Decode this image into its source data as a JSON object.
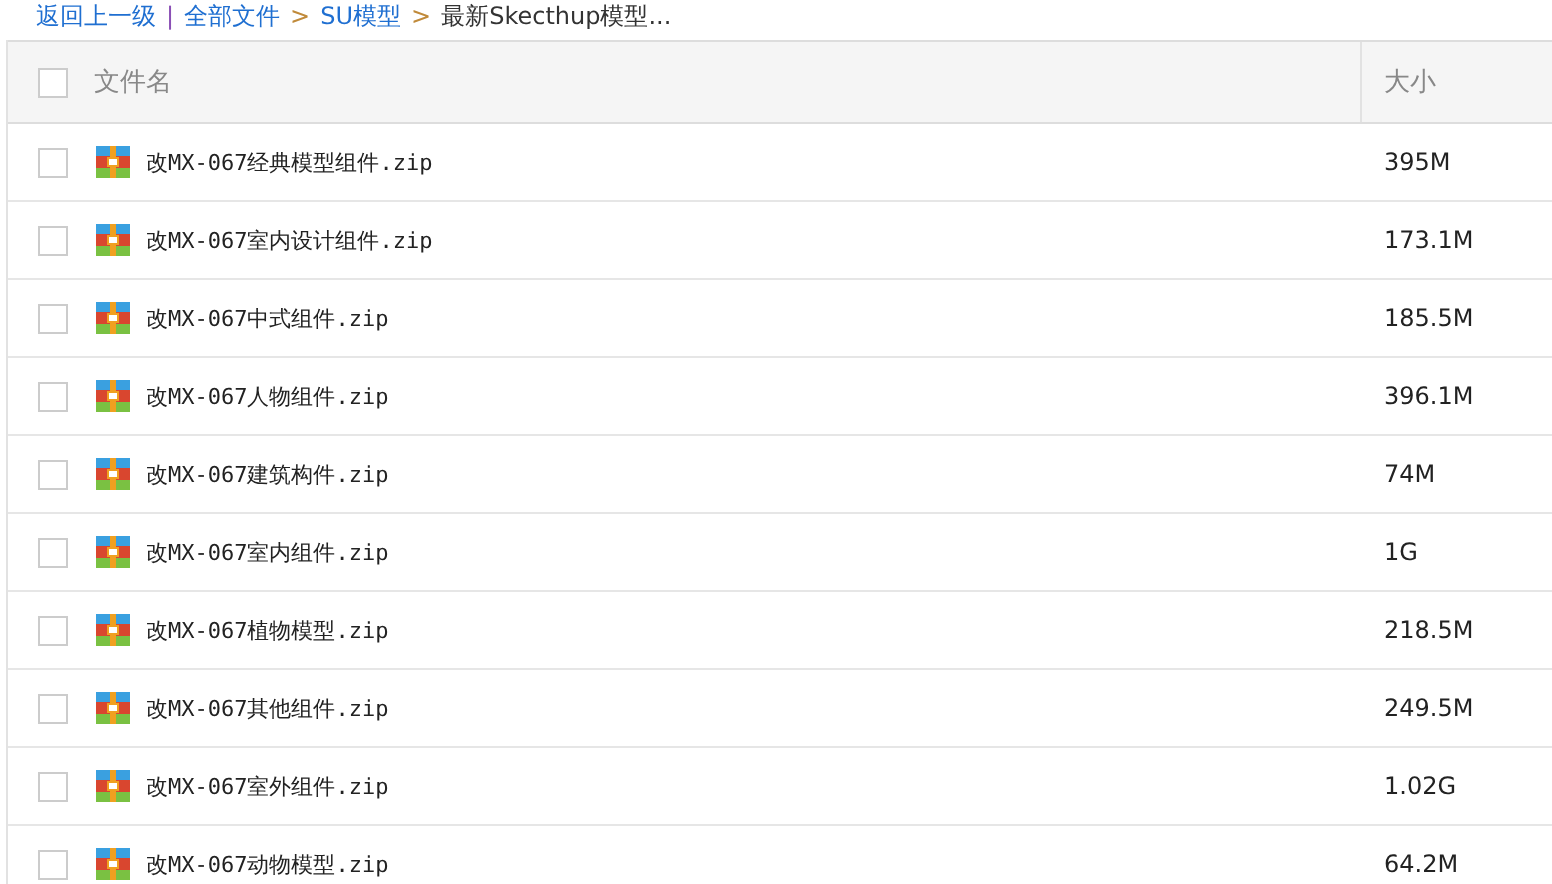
{
  "breadcrumb": [
    {
      "label": "返回上一级",
      "kind": "link"
    },
    {
      "separator": "|",
      "label": "全部文件",
      "kind": "link"
    },
    {
      "separator": ">",
      "label": "SU模型",
      "kind": "link"
    },
    {
      "separator": ">",
      "label": "最新Skecthup模型...",
      "kind": "current"
    }
  ],
  "table": {
    "columns": [
      "文件名",
      "大小"
    ],
    "select_all": {
      "checked": false
    },
    "rows": [
      {
        "name": "改MX-067经典模型组件.zip",
        "size": "395M",
        "checked": false
      },
      {
        "name": "改MX-067室内设计组件.zip",
        "size": "173.1M",
        "checked": false
      },
      {
        "name": "改MX-067中式组件.zip",
        "size": "185.5M",
        "checked": false
      },
      {
        "name": "改MX-067人物组件.zip",
        "size": "396.1M",
        "checked": false
      },
      {
        "name": "改MX-067建筑构件.zip",
        "size": "74M",
        "checked": false
      },
      {
        "name": "改MX-067室内组件.zip",
        "size": "1G",
        "checked": false
      },
      {
        "name": "改MX-067植物模型.zip",
        "size": "218.5M",
        "checked": false
      },
      {
        "name": "改MX-067其他组件.zip",
        "size": "249.5M",
        "checked": false
      },
      {
        "name": "改MX-067室外组件.zip",
        "size": "1.02G",
        "checked": false
      },
      {
        "name": "改MX-067动物模型.zip",
        "size": "64.2M",
        "checked": false
      }
    ]
  }
}
